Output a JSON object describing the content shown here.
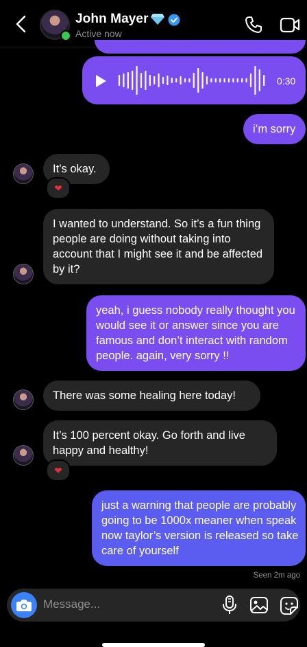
{
  "header": {
    "name": "John Mayer",
    "status": "Active now"
  },
  "messages": {
    "voice_duration": "0:30",
    "m1": "i’m sorry",
    "m2": "It’s okay.",
    "m3": "I wanted to understand. So it’s a fun thing people are doing without taking into account that I might see it and be affected by it?",
    "m4": "yeah, i guess nobody really thought you would see it or answer since you are famous and don’t interact with random people. again, very sorry !!",
    "m5": "There was some healing here today!",
    "m6": "It’s 100 percent okay. Go forth and live happy and healthy!",
    "m7": "just a warning that people are probably going to be 1000x meaner when speak now taylor’s version is released so take care of yourself"
  },
  "reactions": {
    "heart": "❤"
  },
  "seen": "Seen 2m ago",
  "composer": {
    "placeholder": "Message..."
  },
  "colors": {
    "outgoing_purple": "#7a4df0",
    "outgoing_blue": "#5b5cf0",
    "incoming": "#262626",
    "online": "#37c84f",
    "camera": "#3b82f6"
  }
}
